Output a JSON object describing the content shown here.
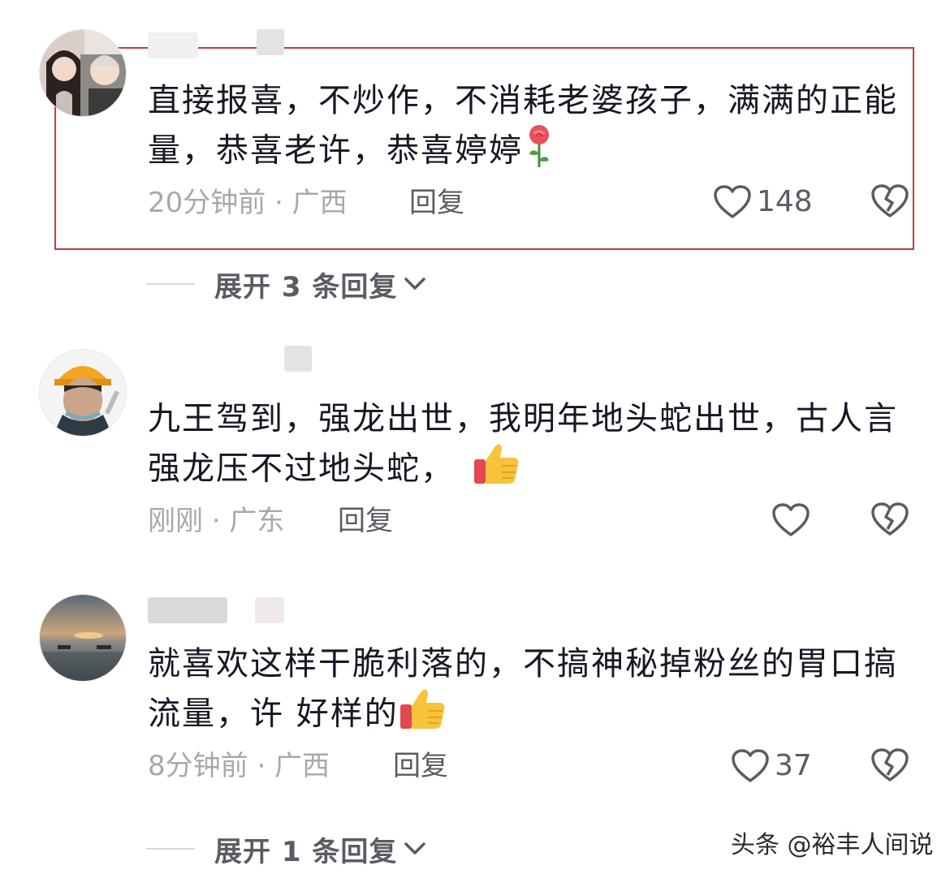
{
  "comments": [
    {
      "text": "直接报喜，不炒作，不消耗老婆孩子，满满的正能量，恭喜老许，恭喜婷婷",
      "emoji": "rose-emoji",
      "time_location": "20分钟前 · 广西",
      "reply_label": "回复",
      "like_count": "148",
      "highlighted": true,
      "expand_label": "展开 3 条回复"
    },
    {
      "text": "九王驾到，强龙出世，我明年地头蛇出世，古人言强龙压不过地头蛇，",
      "emoji": "thumbs-up-emoji",
      "time_location": "刚刚 · 广东",
      "reply_label": "回复",
      "like_count": ""
    },
    {
      "text": "就喜欢这样干脆利落的，不搞神秘掉粉丝的胃口搞流量，许 好样的",
      "emoji": "thumbs-up-emoji",
      "time_location": "8分钟前 · 广西",
      "reply_label": "回复",
      "like_count": "37",
      "expand_label": "展开 1 条回复"
    }
  ],
  "watermark": "头条 @裕丰人间说",
  "colors": {
    "highlight_border": "#c43a3a",
    "meta_text": "#a7a8ac",
    "action_text": "#5b5c63"
  }
}
